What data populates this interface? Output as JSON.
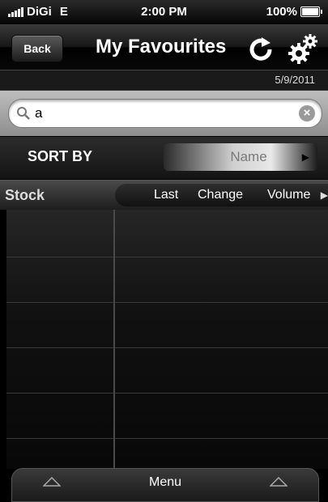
{
  "status_bar": {
    "carrier": "DiGi",
    "network": "E",
    "time": "2:00 PM",
    "battery": "100%"
  },
  "nav": {
    "back_label": "Back",
    "title": "My Favourites",
    "icons": [
      "refresh-icon",
      "gear-icon"
    ]
  },
  "date": "5/9/2011",
  "search": {
    "value": "a",
    "icons": [
      "search-icon",
      "clear-icon"
    ]
  },
  "sort": {
    "label": "SORT BY",
    "selected": "Name"
  },
  "table": {
    "columns": {
      "stock": "Stock",
      "last": "Last",
      "change": "Change",
      "volume": "Volume"
    },
    "rows": []
  },
  "menu": {
    "label": "Menu"
  },
  "colors": {
    "background": "#000000",
    "search_bar": "#a8a8a8",
    "sort_value_text": "#7a7a7a"
  }
}
